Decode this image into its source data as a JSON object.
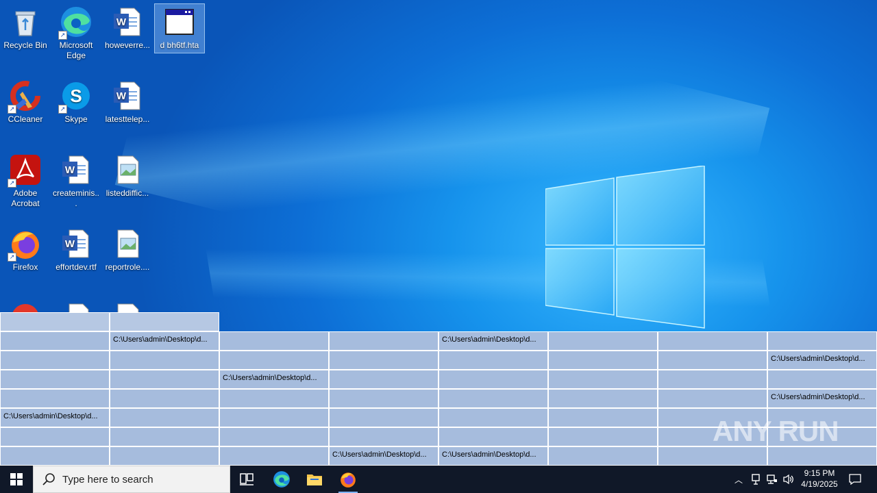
{
  "desktop": {
    "icons": [
      {
        "label": "Recycle Bin",
        "icon": "recycle-bin-icon"
      },
      {
        "label": "Microsoft Edge",
        "icon": "edge-icon"
      },
      {
        "label": "howeverre...",
        "icon": "word-document-icon"
      },
      {
        "label": "d bh6tf.hta",
        "icon": "hta-window-icon"
      },
      {
        "label": "CCleaner",
        "icon": "ccleaner-icon"
      },
      {
        "label": "Skype",
        "icon": "skype-icon"
      },
      {
        "label": "latesttelep...",
        "icon": "word-document-icon"
      },
      {
        "label": "Adobe Acrobat",
        "icon": "acrobat-icon"
      },
      {
        "label": "createminis...",
        "icon": "word-document-icon"
      },
      {
        "label": "listeddiffic...",
        "icon": "image-file-icon"
      },
      {
        "label": "Firefox",
        "icon": "firefox-icon"
      },
      {
        "label": "effortdev.rtf",
        "icon": "word-document-icon"
      },
      {
        "label": "reportrole....",
        "icon": "image-file-icon"
      }
    ]
  },
  "grid": {
    "path_text": "C:\\Users\\admin\\Desktop\\d...",
    "cell_color": "#a6bcdd",
    "filled_cells": [
      [
        0,
        1
      ],
      [
        0,
        4
      ],
      [
        1,
        7
      ],
      [
        2,
        2
      ],
      [
        3,
        7
      ],
      [
        4,
        0
      ],
      [
        6,
        3
      ],
      [
        6,
        4
      ]
    ]
  },
  "taskbar": {
    "search_placeholder": "Type here to search",
    "time": "9:15 PM",
    "date": "4/19/2025"
  },
  "watermark": "ANY RUN"
}
